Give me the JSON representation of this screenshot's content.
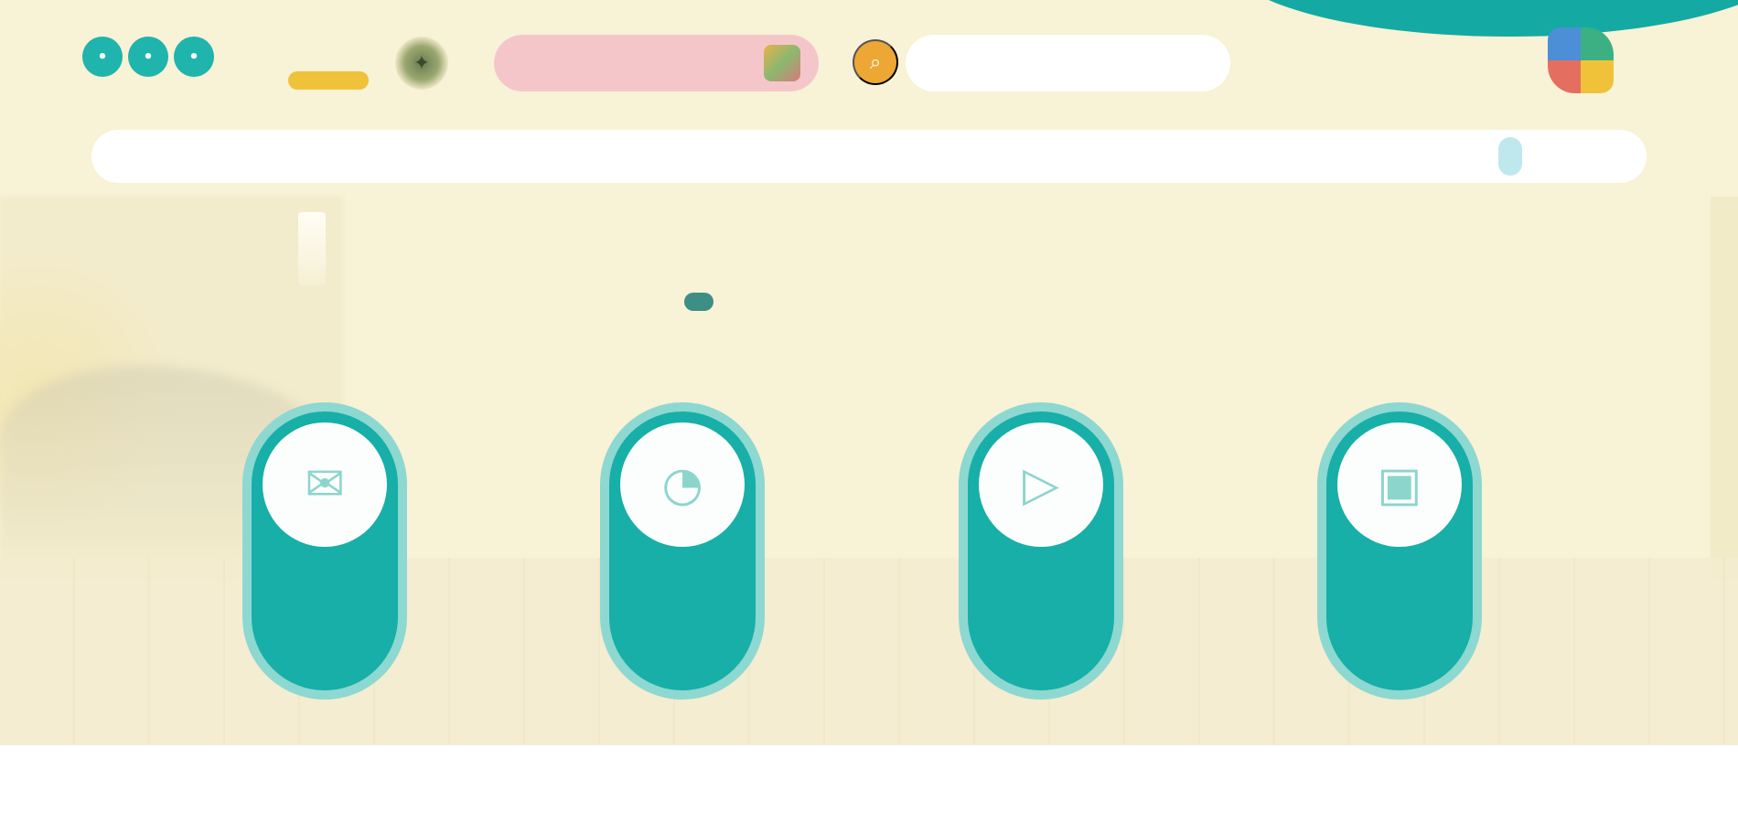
{
  "colors": {
    "teal": "#17afa7",
    "cream": "#f8f2d6",
    "orange": "#eca734",
    "pink": "#f5c6c9",
    "gold": "#f0c23a"
  },
  "header": {
    "social": [
      {
        "icon": "social-icon-1",
        "glyph": "•"
      },
      {
        "icon": "social-icon-2",
        "glyph": "•"
      },
      {
        "icon": "social-icon-3",
        "glyph": "•"
      }
    ],
    "lang_text": "",
    "lang_badge": "",
    "emblem_icon": "emblem-icon",
    "pink_pill_label": "",
    "search_icon": "search-icon",
    "search_placeholder": "",
    "logo_top": "",
    "logo_bottom": ""
  },
  "nav": {
    "items": [
      {
        "label": ""
      },
      {
        "label": ""
      },
      {
        "label": ""
      },
      {
        "label": ""
      },
      {
        "label": ""
      },
      {
        "label": ""
      }
    ]
  },
  "hero": {
    "headline": "",
    "subline": ""
  },
  "cards": [
    {
      "icon": "gallery-icon",
      "glyph": "▣",
      "title": "",
      "subtitle": ""
    },
    {
      "icon": "play-icon",
      "glyph": "▷",
      "title": "",
      "subtitle": ""
    },
    {
      "icon": "clock-icon",
      "glyph": "◔",
      "title": "",
      "subtitle": ""
    },
    {
      "icon": "mail-icon",
      "glyph": "✉",
      "title": "",
      "subtitle": ""
    }
  ]
}
